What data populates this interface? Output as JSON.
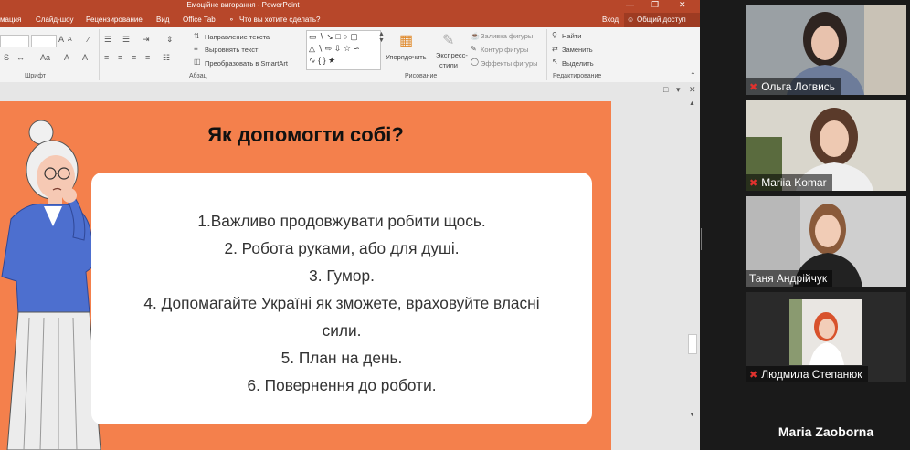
{
  "window": {
    "title": "Емоційне вигорання - PowerPoint"
  },
  "ribbon_tabs": [
    "мация",
    "Слайд-шоу",
    "Рецензирование",
    "Вид",
    "Office Tab"
  ],
  "tell_me": "Что вы хотите сделать?",
  "account": {
    "login": "Вход",
    "share": "Общий доступ"
  },
  "ribbon": {
    "groups": {
      "font": "Шрифт",
      "paragraph": "Абзац",
      "drawing": "Рисование",
      "editing": "Редактирование"
    },
    "paragraph": {
      "text_direction": "Направление текста",
      "align_text": "Выровнять текст",
      "convert_smartart": "Преобразовать в SmartArt"
    },
    "drawing": {
      "arrange": "Упорядочить",
      "quick_styles_1": "Экспресс-",
      "quick_styles_2": "стили",
      "shape_fill": "Заливка фигуры",
      "shape_outline": "Контур фигуры",
      "shape_effects": "Эффекты фигуры"
    },
    "editing": {
      "find": "Найти",
      "replace": "Заменить",
      "select": "Выделить"
    }
  },
  "slide": {
    "title": "Як допомогти собі?",
    "items": [
      "1.Важливо продовжувати робити щось.",
      "2. Робота руками, або для душі.",
      "3. Гумор.",
      "4. Допомагайте Україні як зможете, враховуйте власні",
      "сили.",
      "5. План на день.",
      "6. Повернення до роботи."
    ],
    "colors": {
      "background": "#f4804c",
      "card": "#ffffff"
    }
  },
  "participants": [
    {
      "name": "Ольга Логвись",
      "muted": true
    },
    {
      "name": "Mariia Komar",
      "muted": true
    },
    {
      "name": "Таня Андрійчук",
      "muted": false
    },
    {
      "name": "Людмила Степанюк",
      "muted": true
    },
    {
      "name": "Maria Zaoborna",
      "muted": false
    }
  ]
}
